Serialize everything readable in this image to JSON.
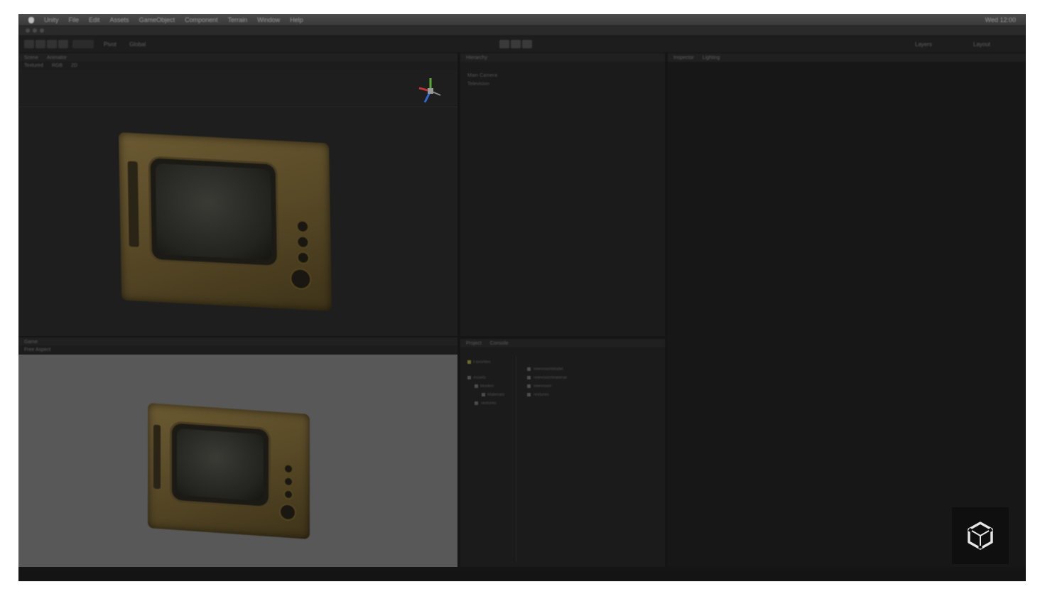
{
  "menubar": {
    "items": [
      "Unity",
      "File",
      "Edit",
      "Assets",
      "GameObject",
      "Component",
      "Terrain",
      "Window",
      "Help"
    ],
    "status": [
      "Wed 12:00"
    ]
  },
  "titlebar": {
    "text": ""
  },
  "toolbar": {
    "transform_tools": [
      "hand",
      "move",
      "rotate",
      "scale"
    ],
    "play_controls": [
      "play",
      "pause",
      "step"
    ],
    "pivot_label": "Pivot",
    "global_label": "Global",
    "layers_label": "Layers",
    "layout_label": "Layout"
  },
  "scene_panel": {
    "tabs": [
      "Scene",
      "Animator"
    ],
    "sub_tabs": [
      "Textured",
      "RGB",
      "2D"
    ]
  },
  "game_panel": {
    "tabs": [
      "Game"
    ],
    "sub_tabs": [
      "Free Aspect"
    ]
  },
  "hierarchy_panel": {
    "tabs": [
      "Hierarchy"
    ],
    "items": [
      "Main Camera",
      "Television"
    ]
  },
  "inspector_panel": {
    "tabs": [
      "Inspector",
      "Lighting"
    ]
  },
  "project_panel": {
    "tabs": [
      "Project",
      "Console"
    ],
    "tree": [
      "Favorites",
      "Assets",
      "Models",
      "Materials",
      "Textures"
    ],
    "files": [
      "TelevisionModel",
      "TelevisionMaterial",
      "Television",
      "Textures"
    ]
  },
  "colors": {
    "tv_casing": "#6b5a32",
    "scene_bg": "#1e1e1e",
    "game_bg": "#585858",
    "gizmo_x": "#b33",
    "gizmo_y": "#5a3",
    "gizmo_z": "#36c"
  },
  "icons": [
    "apple-icon",
    "unity-logo-icon",
    "axis-gizmo-icon"
  ]
}
